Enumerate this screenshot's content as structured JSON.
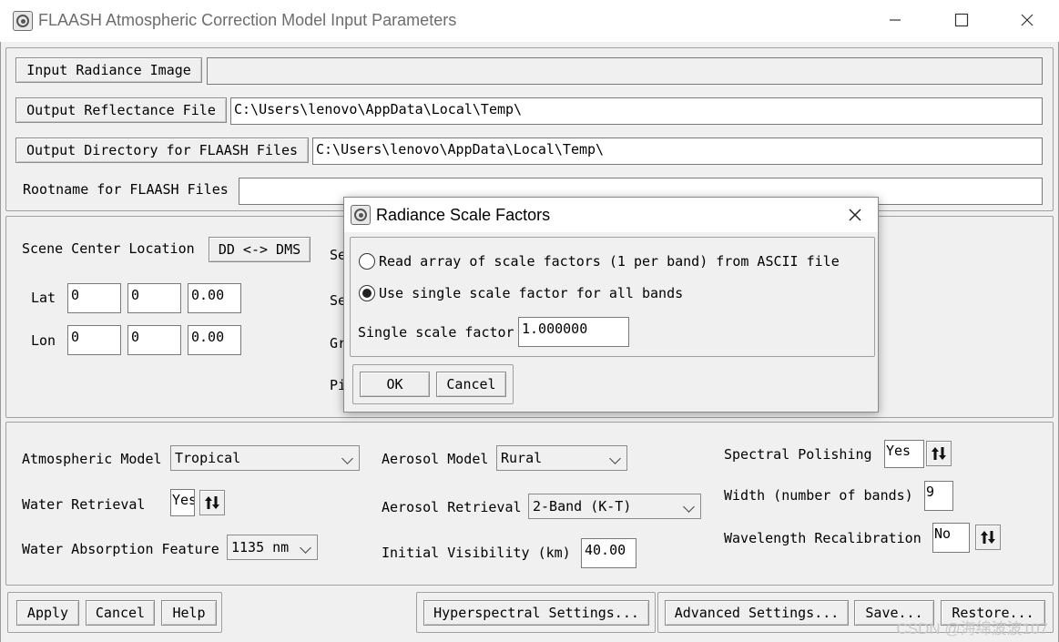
{
  "window": {
    "title": "FLAASH Atmospheric Correction Model Input Parameters"
  },
  "files": {
    "input_radiance_label": "Input Radiance Image",
    "input_radiance_value": "",
    "output_reflectance_label": "Output Reflectance File",
    "output_reflectance_value": "C:\\Users\\lenovo\\AppData\\Local\\Temp\\",
    "output_directory_label": "Output Directory for FLAASH Files",
    "output_directory_value": "C:\\Users\\lenovo\\AppData\\Local\\Temp\\",
    "rootname_label": "Rootname for FLAASH Files",
    "rootname_value": ""
  },
  "scene": {
    "center_label": "Scene Center Location",
    "ddms_button": "DD <-> DMS",
    "lat_label": "Lat",
    "lat": [
      "0",
      "0",
      "0.00"
    ],
    "lon_label": "Lon",
    "lon": [
      "0",
      "0",
      "0.00"
    ],
    "partial_labels": [
      "Se",
      "Se",
      "Gr",
      "Pi"
    ]
  },
  "atmos": {
    "model_label": "Atmospheric Model",
    "model_value": "Tropical",
    "water_retrieval_label": "Water Retrieval",
    "water_retrieval_value": "Yes",
    "water_absorption_label": "Water Absorption Feature",
    "water_absorption_value": "1135 nm",
    "aerosol_model_label": "Aerosol Model",
    "aerosol_model_value": "Rural",
    "aerosol_retrieval_label": "Aerosol Retrieval",
    "aerosol_retrieval_value": "2-Band (K-T)",
    "initial_visibility_label": "Initial Visibility (km)",
    "initial_visibility_value": "40.00",
    "spectral_polishing_label": "Spectral Polishing",
    "spectral_polishing_value": "Yes",
    "width_label": "Width (number of bands)",
    "width_value": "9",
    "wavelength_recal_label": "Wavelength Recalibration",
    "wavelength_recal_value": "No"
  },
  "bottom": {
    "apply": "Apply",
    "cancel": "Cancel",
    "help": "Help",
    "hyperspectral": "Hyperspectral Settings...",
    "advanced": "Advanced Settings...",
    "save": "Save...",
    "restore": "Restore..."
  },
  "dialog": {
    "title": "Radiance Scale Factors",
    "option_ascii": "Read array of scale factors (1 per band) from ASCII file",
    "option_single": "Use single scale factor for all bands",
    "single_label": "Single scale factor",
    "single_value": "1.000000",
    "ok": "OK",
    "cancel": "Cancel"
  },
  "watermark": "CSDN @海绵波波107",
  "icons": {
    "app": "envi-app-icon",
    "minimize": "minimize-icon",
    "maximize": "maximize-icon",
    "close": "close-icon",
    "toggle": "up-down-arrows-icon",
    "dropdown": "chevron-down-icon"
  }
}
